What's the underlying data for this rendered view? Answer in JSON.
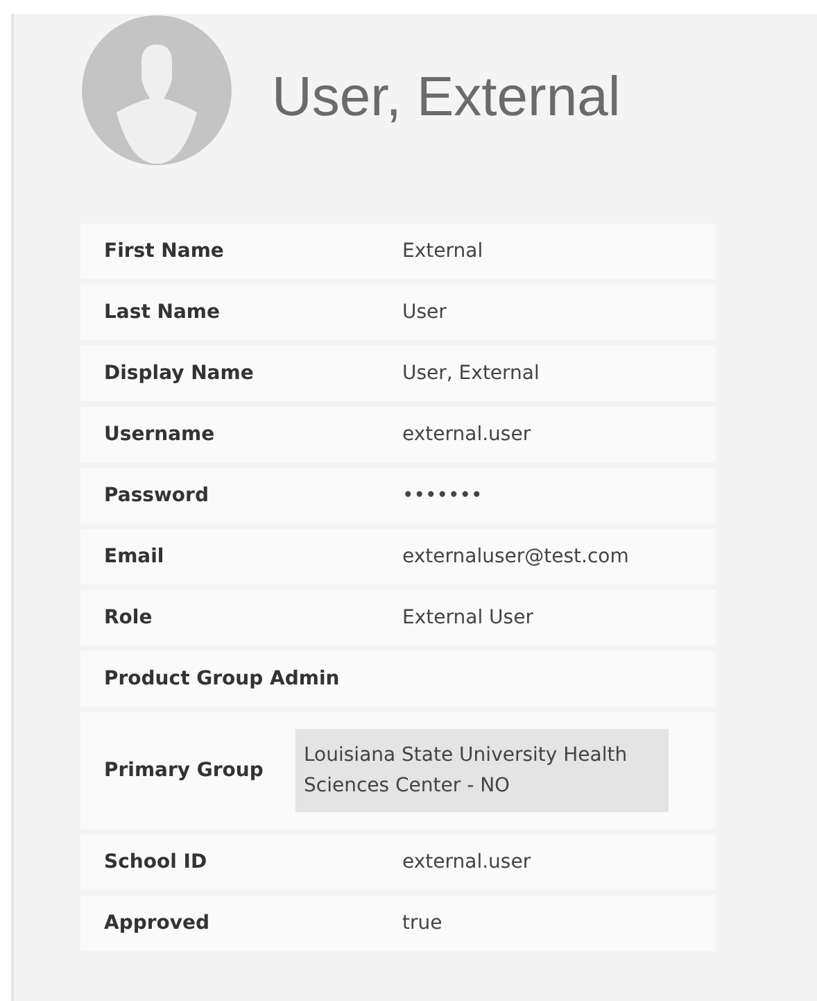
{
  "profile": {
    "name": "User, External"
  },
  "fields": [
    {
      "label": "First Name",
      "value": "External",
      "kind": "text"
    },
    {
      "label": "Last Name",
      "value": "User",
      "kind": "text"
    },
    {
      "label": "Display Name",
      "value": "User, External",
      "kind": "text"
    },
    {
      "label": "Username",
      "value": "external.user",
      "kind": "text"
    },
    {
      "label": "Password",
      "value": "•••••••",
      "kind": "text"
    },
    {
      "label": "Email",
      "value": "externaluser@test.com",
      "kind": "text"
    },
    {
      "label": "Role",
      "value": "External User",
      "kind": "text"
    },
    {
      "label": "Product Group Admin",
      "kind": "text"
    },
    {
      "label": "Primary Group",
      "value": "Louisiana State University Health Sciences Center - NO",
      "kind": "box"
    },
    {
      "label": "School ID",
      "value": "external.user",
      "kind": "text"
    },
    {
      "label": "Approved",
      "value": "true",
      "kind": "text"
    }
  ]
}
